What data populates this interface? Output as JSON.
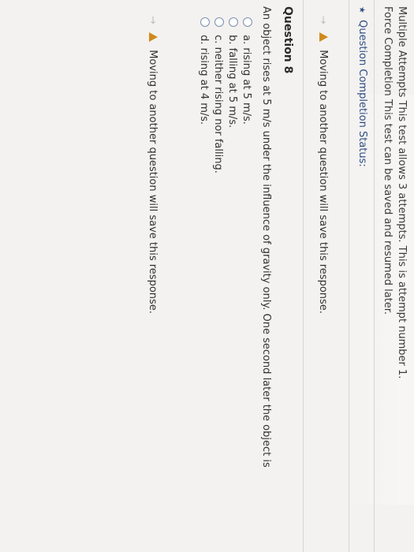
{
  "header": {
    "attempts_line": "Multiple Attempts  This test allows 3 attempts. This is attempt number 1.",
    "completion_line": "Force Completion  This test can be saved and resumed later."
  },
  "status": {
    "label": "Question Completion Status:"
  },
  "notice": {
    "text": "Moving to another question will save this response."
  },
  "question": {
    "title": "Question 8",
    "text": "An object rises at 5 m/s under the influence of gravity only. One second later the object is",
    "options": [
      {
        "letter": "a.",
        "text": "rising at 5 m/s."
      },
      {
        "letter": "b.",
        "text": "falling at 5 m/s."
      },
      {
        "letter": "c.",
        "text": "neither rising nor falling."
      },
      {
        "letter": "d.",
        "text": "rising at 4 m/s."
      }
    ]
  },
  "notice_bottom": {
    "text": "Moving to another question will save this response."
  }
}
